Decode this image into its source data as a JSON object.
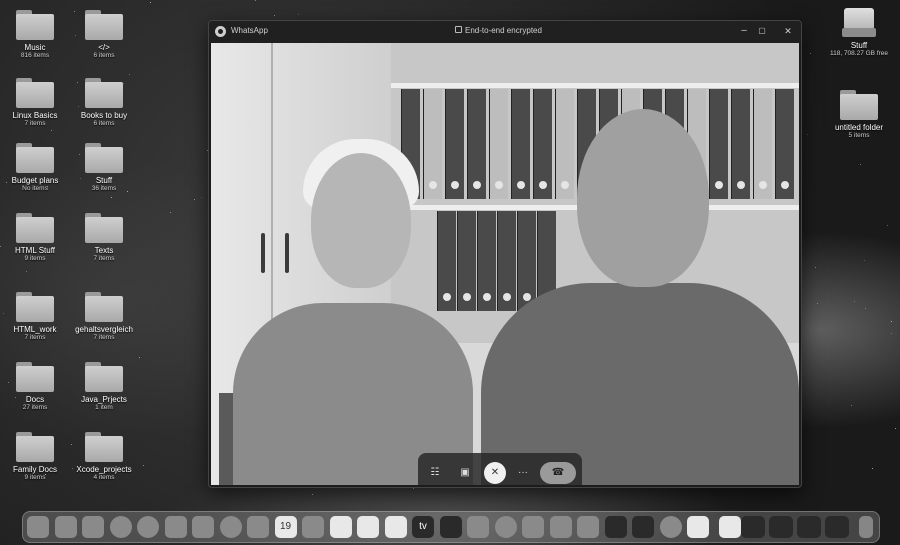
{
  "desktop": {
    "left_icons": [
      {
        "name": "Music",
        "count": "816 items"
      },
      {
        "name": "</>",
        "count": "6 items"
      },
      {
        "name": "Linux Basics",
        "count": "7 items"
      },
      {
        "name": "Books to buy",
        "count": "6 items"
      },
      {
        "name": "Budget plans",
        "count": "No items"
      },
      {
        "name": "Stuff",
        "count": "36 items"
      },
      {
        "name": "HTML Stuff",
        "count": "9 items"
      },
      {
        "name": "Texts",
        "count": "7 items"
      },
      {
        "name": "HTML_work",
        "count": "7 items"
      },
      {
        "name": "gehaltsvergleich",
        "count": "7 items"
      },
      {
        "name": "Docs",
        "count": "27 items"
      },
      {
        "name": "Java_Prjects",
        "count": "1 item"
      },
      {
        "name": "Family Docs",
        "count": "9 items"
      },
      {
        "name": "Xcode_projects",
        "count": "4 items"
      }
    ],
    "right_icons": [
      {
        "name": "Stuff",
        "count": "118, 708.27 GB free",
        "kind": "drive"
      },
      {
        "name": "untitled folder",
        "count": "5 items",
        "kind": "folder"
      }
    ]
  },
  "window": {
    "app_name": "WhatsApp",
    "title": "End-to-end encrypted",
    "controls": {
      "minimize": "–",
      "maximize": "▢",
      "close": "✕"
    }
  },
  "call_bar": {
    "buttons": [
      "participants-icon",
      "video-camera-icon",
      "microphone-muted-icon",
      "more-icon",
      "end-call-icon"
    ],
    "more_label": "···"
  },
  "dock": {
    "items": [
      "finder-icon",
      "launchpad-icon",
      "safari-icon",
      "whatsapp-icon",
      "messages-icon",
      "maps-icon",
      "photos-icon",
      "settings-icon",
      "facetime-icon",
      "calendar-icon",
      "blank-app-icon",
      "reminders-icon",
      "notes-icon",
      "freeform-icon",
      "apple-tv-icon",
      "music-icon",
      "app-store-icon",
      "chatgpt-icon",
      "pencil-icon",
      "numbers-icon",
      "preview-icon",
      "terminal-icon",
      "vscode-icon",
      "spotify-icon",
      "printer-icon"
    ],
    "calendar_day": "19",
    "tv_label": "tv"
  }
}
